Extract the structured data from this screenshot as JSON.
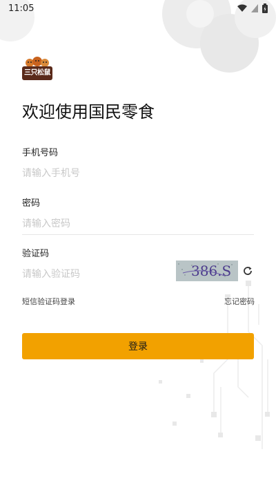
{
  "status_bar": {
    "time": "11:05"
  },
  "brand": {
    "logo_text": "三只松鼠",
    "accent_color": "#f2a100"
  },
  "title": "欢迎使用国民零食",
  "phone": {
    "label": "手机号码",
    "placeholder": "请输入手机号"
  },
  "password": {
    "label": "密码",
    "placeholder": "请输入密码"
  },
  "captcha": {
    "label": "验证码",
    "placeholder": "请输入验证码",
    "image_text": "386.S"
  },
  "links": {
    "sms_login": "短信验证码登录",
    "forgot_password": "忘记密码"
  },
  "login_button": "登录"
}
